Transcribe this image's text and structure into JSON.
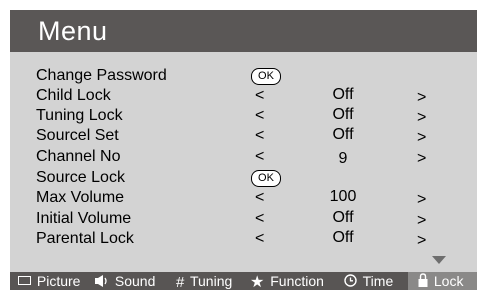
{
  "menu": {
    "title": "Menu"
  },
  "items": [
    {
      "label": "Change Password",
      "kind": "ok",
      "button": "OK"
    },
    {
      "label": "Child Lock",
      "kind": "select",
      "left": "<",
      "value": "Off",
      "right": ">"
    },
    {
      "label": "Tuning Lock",
      "kind": "select",
      "left": "<",
      "value": "Off",
      "right": ">"
    },
    {
      "label": "Sourcel Set",
      "kind": "select",
      "left": "<",
      "value": "Off",
      "right": ">"
    },
    {
      "label": "Channel No",
      "kind": "select",
      "left": "<",
      "value": "9",
      "right": ">"
    },
    {
      "label": "Source Lock",
      "kind": "ok",
      "button": "OK"
    },
    {
      "label": "Max Volume",
      "kind": "select",
      "left": "<",
      "value": "100",
      "right": ">"
    },
    {
      "label": "Initial Volume",
      "kind": "select",
      "left": "<",
      "value": "Off",
      "right": ">"
    },
    {
      "label": "Parental Lock",
      "kind": "select",
      "left": "<",
      "value": "Off",
      "right": ">"
    }
  ],
  "tabs": [
    {
      "label": "Picture",
      "icon": "picture-icon"
    },
    {
      "label": "Sound",
      "icon": "speaker-icon"
    },
    {
      "label": "Tuning",
      "icon": "grid-icon"
    },
    {
      "label": "Function",
      "icon": "star-icon"
    },
    {
      "label": "Time",
      "icon": "clock-icon"
    },
    {
      "label": "Lock",
      "icon": "lock-icon",
      "active": true
    }
  ],
  "colors": {
    "header": "#5a5756",
    "panel": "#d3d3d3",
    "footer": "#585554",
    "active_tab": "#8a8988"
  }
}
